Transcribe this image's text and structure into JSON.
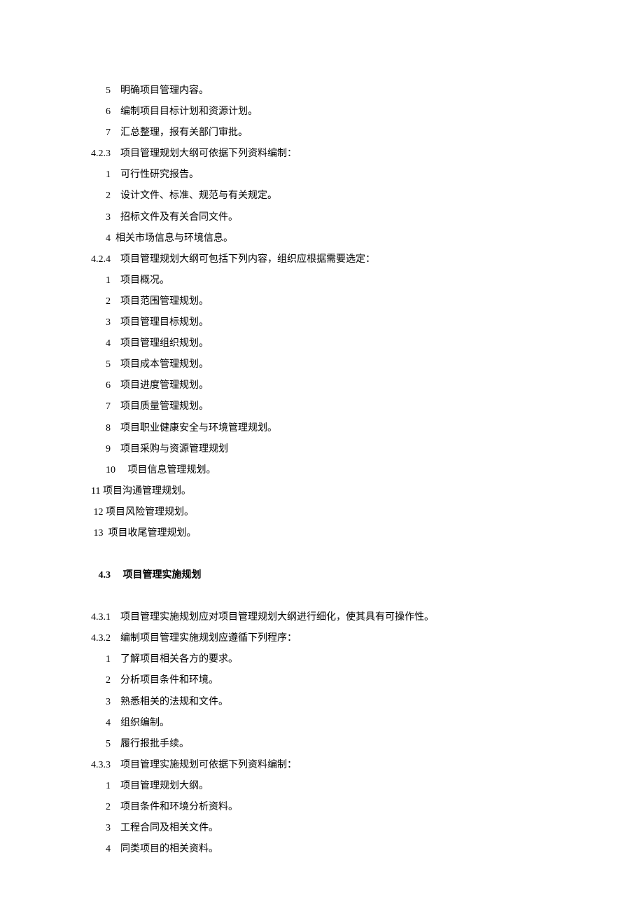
{
  "lines_top": [
    "      5    明确项目管理内容。",
    "      6    编制项目目标计划和资源计划。",
    "      7    汇总整理，报有关部门审批。",
    "4.2.3    项目管理规划大纲可依据下列资料编制：",
    "      1    可行性研究报告。",
    "      2    设计文件、标准、规范与有关规定。",
    "      3    招标文件及有关合同文件。",
    "      4  相关市场信息与环境信息。",
    "4.2.4    项目管理规划大纲可包括下列内容，组织应根据需要选定：",
    "      1    项目概况。",
    "      2    项目范围管理规划。",
    "      3    项目管理目标规划。",
    "      4    项目管理组织规划。",
    "      5    项目成本管理规划。",
    "      6    项目进度管理规划。",
    "      7    项目质量管理规划。",
    "      8    项目职业健康安全与环境管理规划。",
    "      9    项目采购与资源管理规划",
    "      10     项目信息管理规划。",
    "11 项目沟通管理规划。",
    " 12 项目风险管理规划。",
    " 13  项目收尾管理规划。"
  ],
  "section_heading": "   4.3     项目管理实施规划",
  "lines_bottom": [
    "4.3.1    项目管理实施规划应对项目管理规划大纲进行细化，使其具有可操作性。",
    "4.3.2    编制项目管理实施规划应遵循下列程序：",
    "      1    了解项目相关各方的要求。",
    "      2    分析项目条件和环境。",
    "      3    熟悉相关的法规和文件。",
    "      4    组织编制。",
    "      5    履行报批手续。",
    "4.3.3    项目管理实施规划可依据下列资料编制：",
    "      1    项目管理规划大纲。",
    "      2    项目条件和环境分析资料。",
    "      3    工程合同及相关文件。",
    "      4    同类项目的相关资料。"
  ]
}
